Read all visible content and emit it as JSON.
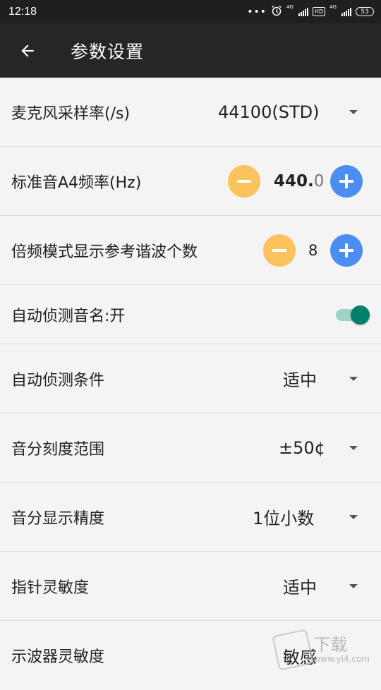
{
  "status_bar": {
    "time": "12:18",
    "dots": "•••",
    "network_1": "4G",
    "hd": "HD",
    "network_2": "4G",
    "battery": "53"
  },
  "app_bar": {
    "title": "参数设置"
  },
  "settings": {
    "sample_rate": {
      "label": "麦克风采样率(/s)",
      "value": "44100(STD)"
    },
    "a4_freq": {
      "label": "标准音A4频率(Hz)",
      "value_main": "440.",
      "value_decimal": "0"
    },
    "harmonics": {
      "label": "倍频模式显示参考谐波个数",
      "value": "8"
    },
    "auto_detect_note": {
      "label": "自动侦测音名:开",
      "enabled": true
    },
    "auto_detect_condition": {
      "label": "自动侦测条件",
      "value": "适中"
    },
    "cent_range": {
      "label": "音分刻度范围",
      "value": "±50¢"
    },
    "cent_precision": {
      "label": "音分显示精度",
      "value": "1位小数"
    },
    "needle_sensitivity": {
      "label": "指针灵敏度",
      "value": "适中"
    },
    "oscilloscope_sensitivity": {
      "label": "示波器灵敏度",
      "value": "敏感"
    }
  },
  "watermark": {
    "big": "下载",
    "small": "www.yi4.com"
  },
  "icons": {
    "back": "arrow-left-icon",
    "dropdown": "triangle-down-icon",
    "minus": "minus-circle-icon",
    "plus": "plus-circle-icon"
  },
  "colors": {
    "app_bar": "#262626",
    "minus_button": "#fcc35c",
    "plus_button": "#4c8df2",
    "toggle_thumb": "#00806a",
    "toggle_track": "#9fd3c7"
  }
}
